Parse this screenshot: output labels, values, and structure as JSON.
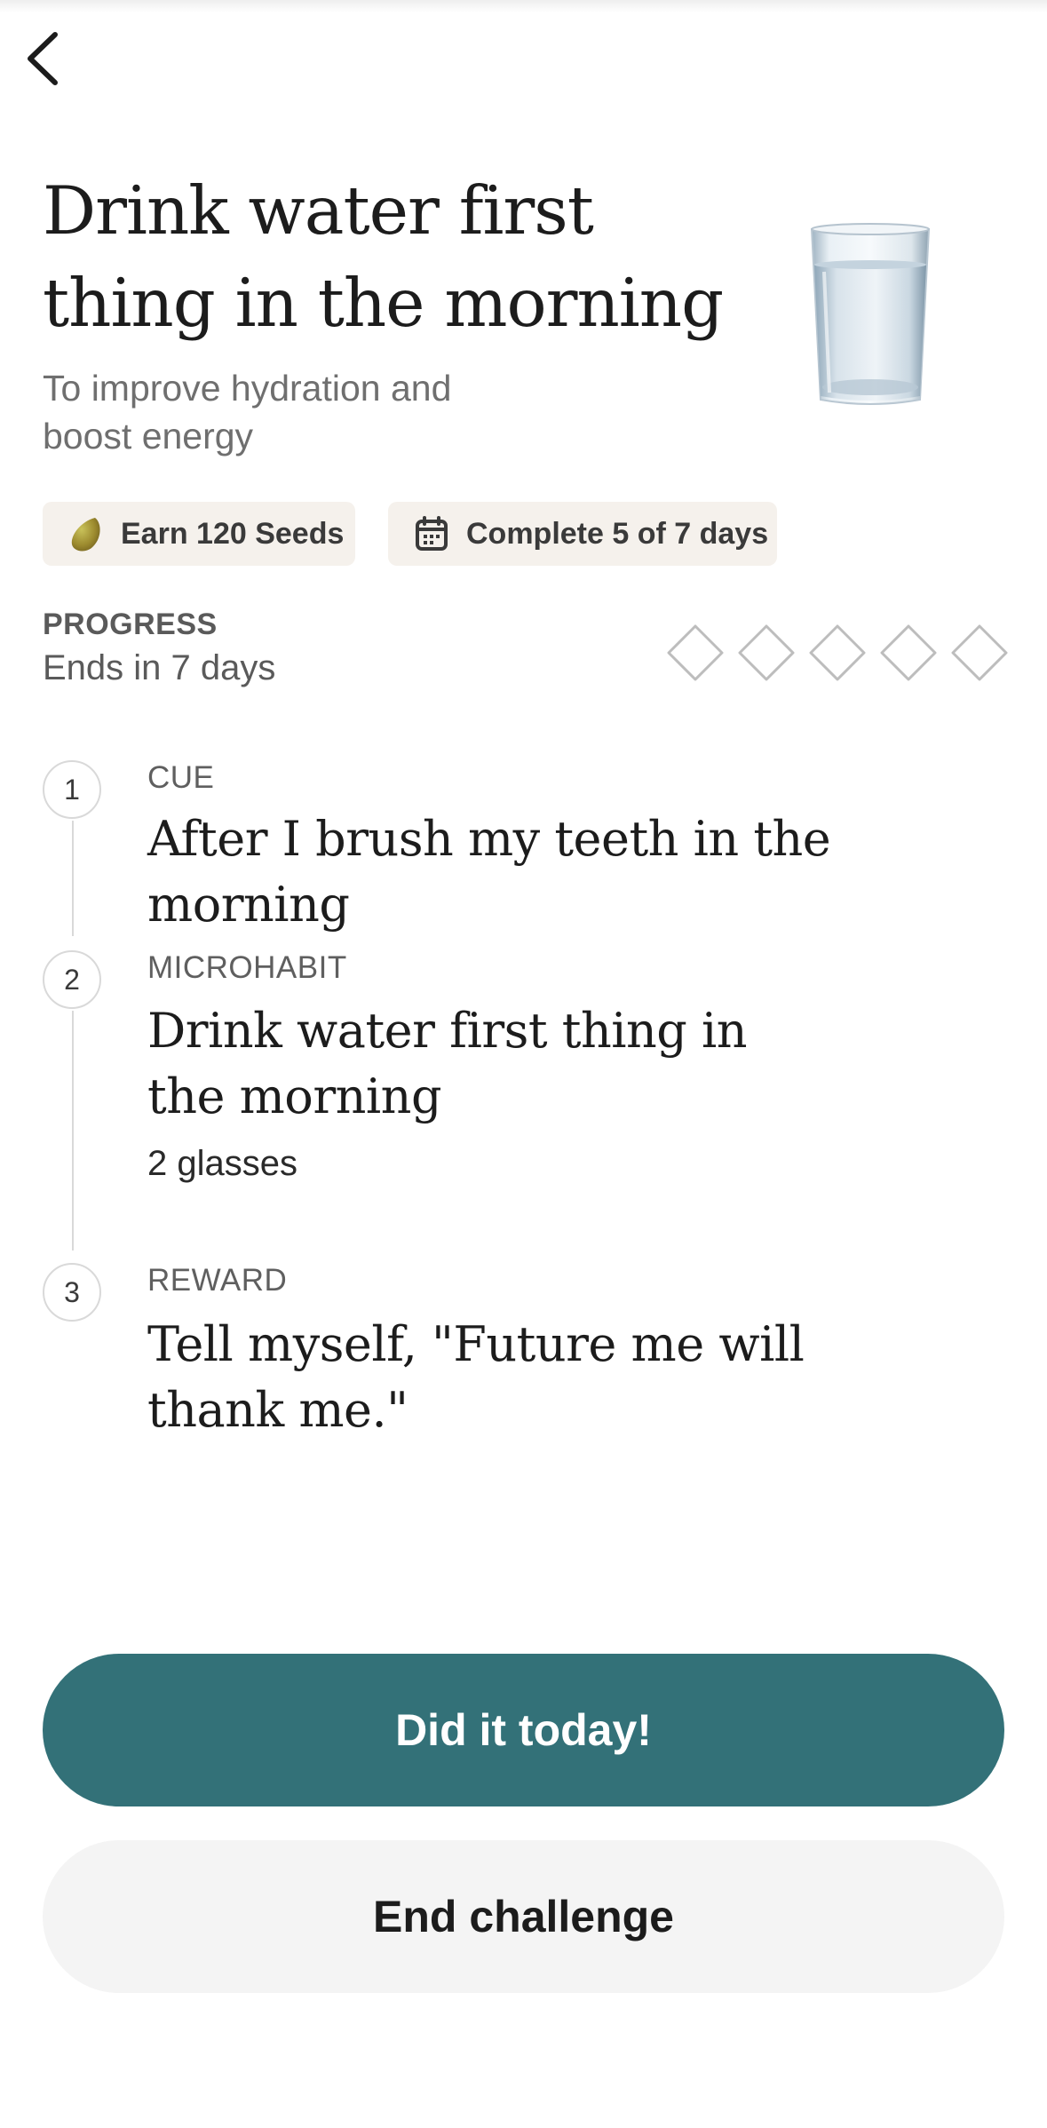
{
  "header": {
    "back_icon": "chevron-left-icon",
    "title": "Drink water first thing in the morning",
    "subtitle": "To improve hydration and boost energy",
    "illustration": "water-glass"
  },
  "badges": {
    "seeds": {
      "icon": "seed-icon",
      "label": "Earn 120 Seeds"
    },
    "days": {
      "icon": "calendar-icon",
      "label": "Complete 5 of 7 days"
    }
  },
  "progress": {
    "label": "PROGRESS",
    "ends_text": "Ends in 7 days",
    "completed": 0,
    "total": 5
  },
  "steps": [
    {
      "number": "1",
      "label": "CUE",
      "text": "After I brush my teeth in the morning",
      "detail": ""
    },
    {
      "number": "2",
      "label": "MICROHABIT",
      "text": "Drink water first thing in the morning",
      "detail": "2 glasses"
    },
    {
      "number": "3",
      "label": "REWARD",
      "text": "Tell myself, \"Future me will thank me.\"",
      "detail": ""
    }
  ],
  "actions": {
    "primary": "Did it today!",
    "secondary": "End challenge"
  },
  "colors": {
    "primary_button": "#337178",
    "secondary_button": "#f4f4f4",
    "badge_bg": "#f5f1ec",
    "diamond_stroke": "#bdbdbd"
  }
}
